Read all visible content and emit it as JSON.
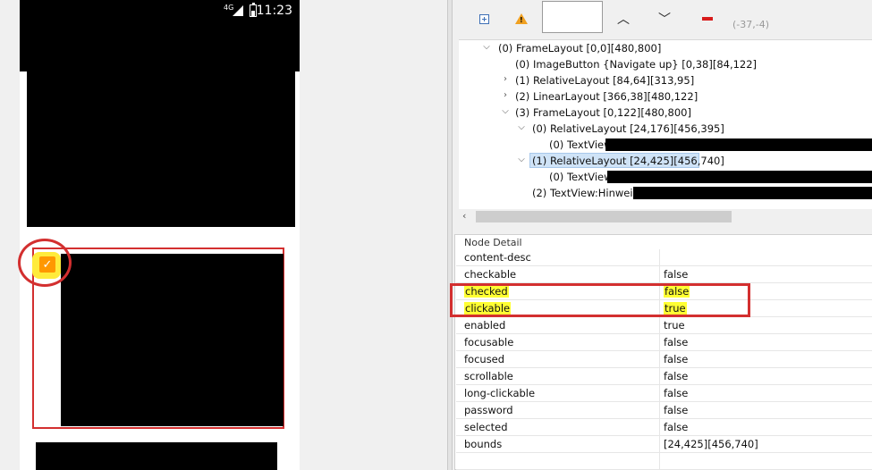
{
  "device": {
    "status_bar": {
      "network": "4G",
      "clock": "11:23"
    }
  },
  "toolbar": {
    "search_value": "",
    "coords": "(-37,-4)"
  },
  "tree": {
    "rows": [
      {
        "label": "(0) FrameLayout [0,0][480,800]"
      },
      {
        "label": "(0) ImageButton {Navigate up} [0,38][84,122]"
      },
      {
        "label": "(1) RelativeLayout [84,64][313,95]"
      },
      {
        "label": "(2) LinearLayout [366,38][480,122]"
      },
      {
        "label": "(3) FrameLayout [0,122][480,800]"
      },
      {
        "label": "(0) RelativeLayout [24,176][456,395]"
      },
      {
        "label": "(0) TextView:"
      },
      {
        "label": "(1) RelativeLayout [24,425][456,740]"
      },
      {
        "label": "(0) TextView:"
      },
      {
        "label": "(2) TextView:Hinweis:"
      }
    ]
  },
  "node_detail": {
    "title": "Node Detail",
    "properties": [
      {
        "key": "content-desc",
        "value": ""
      },
      {
        "key": "checkable",
        "value": "false"
      },
      {
        "key": "checked",
        "value": "false"
      },
      {
        "key": "clickable",
        "value": "true"
      },
      {
        "key": "enabled",
        "value": "true"
      },
      {
        "key": "focusable",
        "value": "false"
      },
      {
        "key": "focused",
        "value": "false"
      },
      {
        "key": "scrollable",
        "value": "false"
      },
      {
        "key": "long-clickable",
        "value": "false"
      },
      {
        "key": "password",
        "value": "false"
      },
      {
        "key": "selected",
        "value": "false"
      },
      {
        "key": "bounds",
        "value": "[24,425][456,740]"
      }
    ]
  },
  "colors": {
    "annotation_red": "#d32f2f",
    "highlight_yellow": "#ffff33",
    "checkbox_orange": "#ff9800",
    "tree_selection": "#cfe3f7"
  }
}
